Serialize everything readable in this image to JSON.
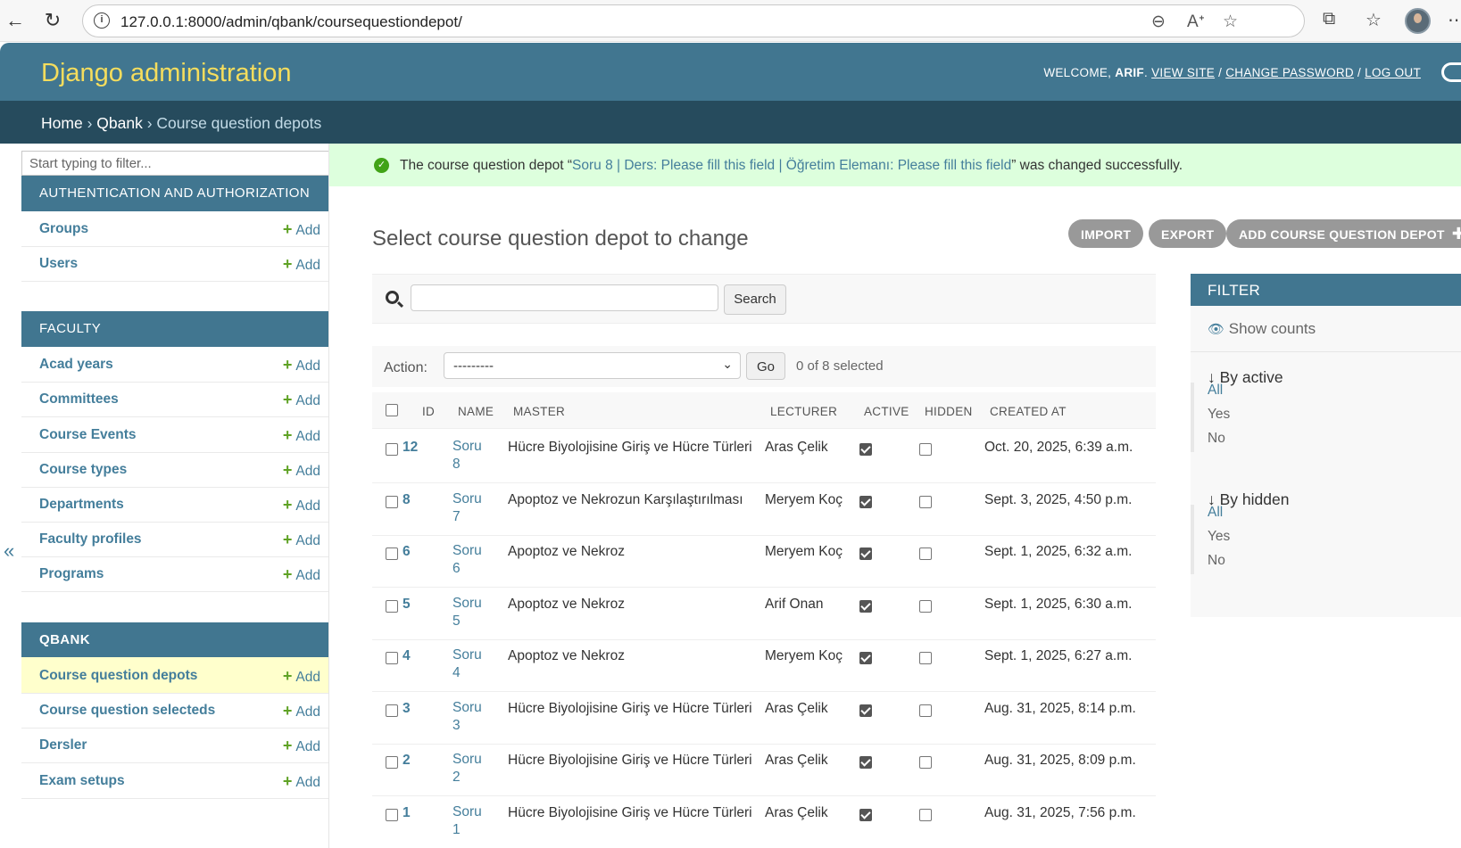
{
  "browser": {
    "url": "127.0.0.1:8000/admin/qbank/coursequestiondepot/"
  },
  "header": {
    "brand": "Django administration",
    "welcome": "WELCOME,",
    "user": "ARIF",
    "view_site": "VIEW SITE",
    "change_password": "CHANGE PASSWORD",
    "log_out": "LOG OUT"
  },
  "breadcrumb": {
    "home": "Home",
    "app": "Qbank",
    "current": "Course question depots",
    "sep": "›"
  },
  "sidebar": {
    "filter_placeholder": "Start typing to filter...",
    "add_label": "Add",
    "modules": [
      {
        "caption": "AUTHENTICATION AND AUTHORIZATION",
        "items": [
          "Groups",
          "Users"
        ]
      },
      {
        "caption": "FACULTY",
        "items": [
          "Acad years",
          "Committees",
          "Course Events",
          "Course types",
          "Departments",
          "Faculty profiles",
          "Programs"
        ]
      },
      {
        "caption": "QBANK",
        "items": [
          "Course question depots",
          "Course question selecteds",
          "Dersler",
          "Exam setups"
        ]
      }
    ],
    "collapse": "«"
  },
  "message": {
    "prefix": "The course question depot “",
    "object": "Soru 8 | Ders: Please fill this field | Öğretim Elemanı: Please fill this field",
    "suffix": "” was changed successfully."
  },
  "content": {
    "title": "Select course question depot to change",
    "import_label": "IMPORT",
    "export_label": "EXPORT",
    "add_label": "ADD COURSE QUESTION DEPOT",
    "search_button": "Search",
    "action_label": "Action:",
    "action_value": "---------",
    "go_label": "Go",
    "counter": "0 of 8 selected"
  },
  "table": {
    "headers": [
      "ID",
      "NAME",
      "MASTER",
      "LECTURER",
      "ACTIVE",
      "HIDDEN",
      "CREATED AT"
    ],
    "rows": [
      {
        "id": "12",
        "name": "Soru 8",
        "master": "Hücre Biyolojisine Giriş ve Hücre Türleri",
        "lecturer": "Aras Çelik",
        "active": true,
        "hidden": false,
        "created": "Oct. 20, 2025, 6:39 a.m."
      },
      {
        "id": "8",
        "name": "Soru 7",
        "master": "Apoptoz ve Nekrozun Karşılaştırılması",
        "lecturer": "Meryem Koç",
        "active": true,
        "hidden": false,
        "created": "Sept. 3, 2025, 4:50 p.m."
      },
      {
        "id": "6",
        "name": "Soru 6",
        "master": "Apoptoz ve Nekroz",
        "lecturer": "Meryem Koç",
        "active": true,
        "hidden": false,
        "created": "Sept. 1, 2025, 6:32 a.m."
      },
      {
        "id": "5",
        "name": "Soru 5",
        "master": "Apoptoz ve Nekroz",
        "lecturer": "Arif Onan",
        "active": true,
        "hidden": false,
        "created": "Sept. 1, 2025, 6:30 a.m."
      },
      {
        "id": "4",
        "name": "Soru 4",
        "master": "Apoptoz ve Nekroz",
        "lecturer": "Meryem Koç",
        "active": true,
        "hidden": false,
        "created": "Sept. 1, 2025, 6:27 a.m."
      },
      {
        "id": "3",
        "name": "Soru 3",
        "master": "Hücre Biyolojisine Giriş ve Hücre Türleri",
        "lecturer": "Aras Çelik",
        "active": true,
        "hidden": false,
        "created": "Aug. 31, 2025, 8:14 p.m."
      },
      {
        "id": "2",
        "name": "Soru 2",
        "master": "Hücre Biyolojisine Giriş ve Hücre Türleri",
        "lecturer": "Aras Çelik",
        "active": true,
        "hidden": false,
        "created": "Aug. 31, 2025, 8:09 p.m."
      },
      {
        "id": "1",
        "name": "Soru 1",
        "master": "Hücre Biyolojisine Giriş ve Hücre Türleri",
        "lecturer": "Aras Çelik",
        "active": true,
        "hidden": false,
        "created": "Aug. 31, 2025, 7:56 p.m."
      }
    ]
  },
  "filter": {
    "title": "FILTER",
    "show_counts": "Show counts",
    "sections": [
      {
        "title": "↓ By active",
        "options": [
          "All",
          "Yes",
          "No"
        ]
      },
      {
        "title": "↓ By hidden",
        "options": [
          "All",
          "Yes",
          "No"
        ]
      }
    ]
  },
  "colors": {
    "header_bg": "#417690",
    "breadcrumb_bg": "#264b5d",
    "brand": "#f5dd5d",
    "link": "#447e9b",
    "success_bg": "#ddffdd",
    "add_plus": "#5fa225"
  }
}
